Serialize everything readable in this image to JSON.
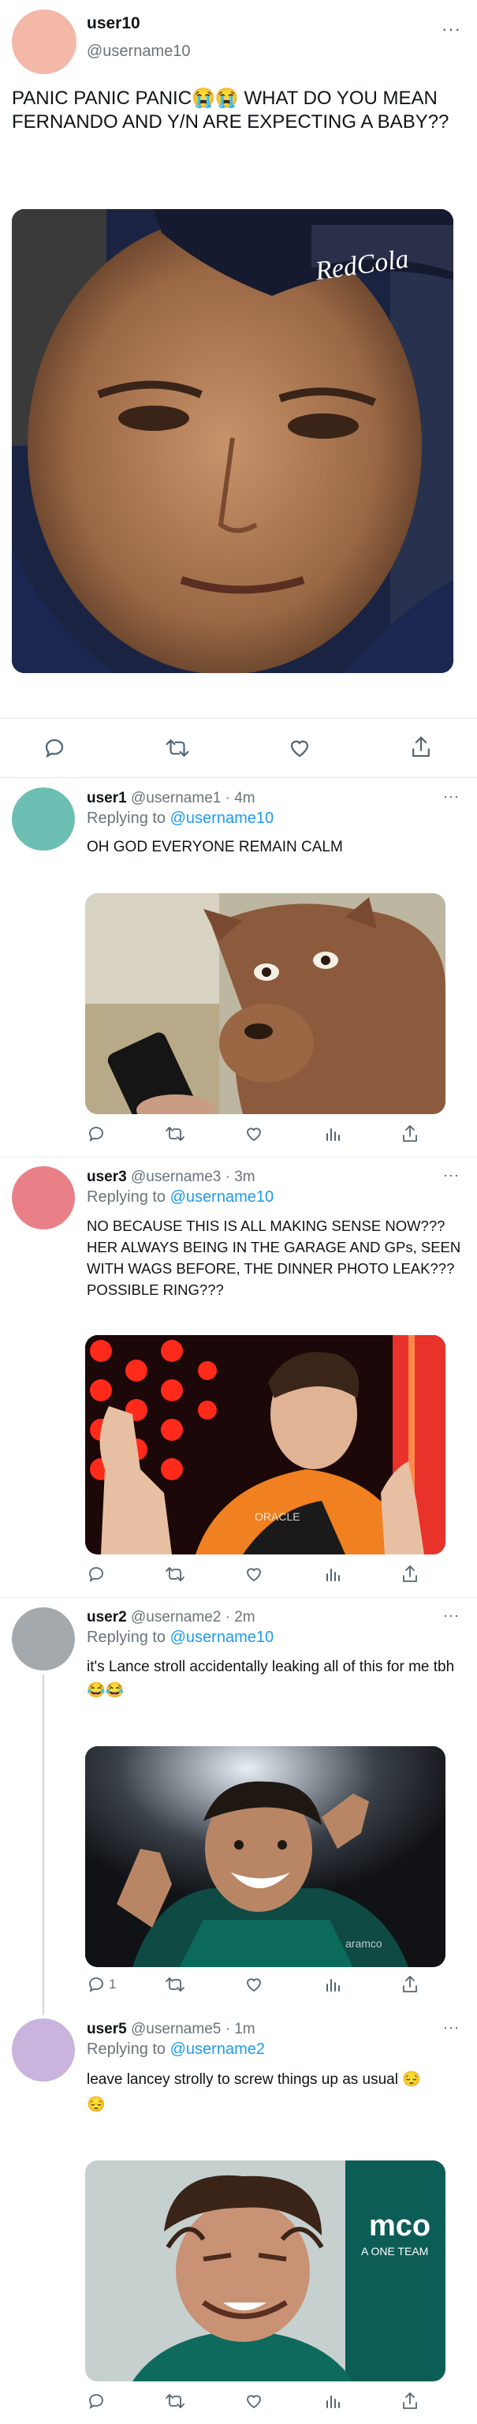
{
  "main_tweet": {
    "user": "user10",
    "handle": "@username10",
    "more_label": "···",
    "text": "PANIC PANIC PANIC😭😭 WHAT DO YOU MEAN FERNANDO AND Y/N ARE EXPECTING A BABY??",
    "avatar_color": "#f3b8a8",
    "image_desc_icon": "man-in-cap-photo"
  },
  "replies": [
    {
      "user": "user1",
      "handle": "@username1",
      "time": "4m",
      "replying_prefix": "Replying to",
      "replying_to": "@username10",
      "text": "OH GOD EVERYONE REMAIN CALM",
      "avatar_color": "#6cbfb2",
      "reply_count": ""
    },
    {
      "user": "user3",
      "handle": "@username3",
      "time": "3m",
      "replying_prefix": "Replying to",
      "replying_to": "@username10",
      "text": "NO BECAUSE THIS IS ALL MAKING SENSE NOW??? HER ALWAYS BEING IN THE GARAGE AND GPs, SEEN WITH WAGS BEFORE, THE DINNER PHOTO LEAK??? POSSIBLE RING???",
      "avatar_color": "#e98088",
      "reply_count": ""
    },
    {
      "user": "user2",
      "handle": "@username2",
      "time": "2m",
      "replying_prefix": "Replying to",
      "replying_to": "@username10",
      "text": "it's Lance stroll accidentally leaking all of this for me tbh 😂😂",
      "avatar_color": "#a4a9ad",
      "reply_count": "1"
    },
    {
      "user": "user5",
      "handle": "@username5",
      "time": "1m",
      "replying_prefix": "Replying to",
      "replying_to": "@username2",
      "text": "leave lancey strolly to screw things up as usual 😔😔",
      "avatar_color": "#c8b4dc",
      "reply_count": ""
    }
  ],
  "colors": {
    "accent": "#1d9bf0",
    "icon": "#536471",
    "divider": "#e6ecf0"
  }
}
